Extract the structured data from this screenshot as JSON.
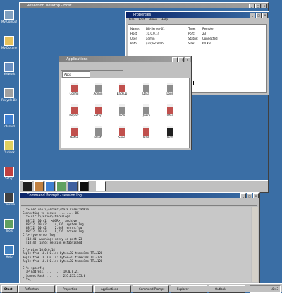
{
  "desktop": {
    "background": "#3a6ea5",
    "icons": [
      {
        "label": "My Computer",
        "icon": "computer-icon",
        "color": "#7f9fbf"
      },
      {
        "label": "My Documents",
        "icon": "folder-icon",
        "color": "#e6c15c"
      },
      {
        "label": "Network",
        "icon": "network-icon",
        "color": "#6a8fc0"
      },
      {
        "label": "Recycle Bin",
        "icon": "recycle-bin-icon",
        "color": "#a0a0a0"
      },
      {
        "label": "Internet",
        "icon": "globe-icon",
        "color": "#3f7fd0"
      },
      {
        "label": "Outlook",
        "icon": "mail-icon",
        "color": "#e0d060"
      },
      {
        "label": "Setup",
        "icon": "setup-icon",
        "color": "#c04040"
      },
      {
        "label": "Console",
        "icon": "console-icon",
        "color": "#404040"
      },
      {
        "label": "Tools",
        "icon": "tools-icon",
        "color": "#60a060"
      },
      {
        "label": "Help",
        "icon": "help-icon",
        "color": "#4080c0"
      }
    ]
  },
  "top_window": {
    "title": "Reflection Desktop - Host"
  },
  "properties_window": {
    "title": "Properties",
    "menu": [
      "File",
      "Edit",
      "View",
      "Help"
    ],
    "rows": [
      [
        "Name:",
        "DB-Server-01",
        "Type:",
        "Remote"
      ],
      [
        "Host:",
        "10.0.0.14",
        "Port:",
        "23"
      ],
      [
        "User:",
        "admin",
        "Status:",
        "Connected"
      ],
      [
        "Path:",
        "/usr/local/db",
        "Size:",
        "64 KB"
      ]
    ]
  },
  "explorer_window": {
    "title": "Applications",
    "address": "Apps",
    "items": [
      {
        "label": "Config",
        "color": "#c0504d"
      },
      {
        "label": "Admin",
        "color": "#8c8c8c"
      },
      {
        "label": "Backup",
        "color": "#c0504d"
      },
      {
        "label": "Data",
        "color": "#8c8c8c"
      },
      {
        "label": "Logs",
        "color": "#8c8c8c"
      },
      {
        "label": "Report",
        "color": "#c0504d"
      },
      {
        "label": "Setup",
        "color": "#c0504d"
      },
      {
        "label": "Tools",
        "color": "#8c8c8c"
      },
      {
        "label": "Query",
        "color": "#8c8c8c"
      },
      {
        "label": "Utils",
        "color": "#c0504d"
      },
      {
        "label": "Notes",
        "color": "#c0504d"
      },
      {
        "label": "Print",
        "color": "#8c8c8c"
      },
      {
        "label": "Sync",
        "color": "#c0504d"
      },
      {
        "label": "Mail",
        "color": "#c0504d"
      },
      {
        "label": "Term",
        "color": "#202020"
      }
    ]
  },
  "terminal": {
    "title": "Command Prompt - session log",
    "lines": [
      "C:\\> net use \\\\server\\share /user:admin",
      "Connecting to server ......... OK",
      "C:\\> dir \\\\server\\share\\logs",
      "  08/12  10:41   <DIR>   archive",
      "  08/12  10:42    14,336  system.log",
      "  08/12  10:42     2,048  error.log",
      "  08/12  10:43     9,216  access.log",
      "C:\\> type error.log",
      "  [10:41] warning: retry on port 23",
      "  [10:42] info: session established",
      "",
      "C:\\> ping 10.0.0.14",
      "Reply from 10.0.0.14: bytes=32 time<1ms TTL=128",
      "Reply from 10.0.0.14: bytes=32 time<1ms TTL=128",
      "Reply from 10.0.0.14: bytes=32 time<1ms TTL=128",
      "",
      "C:\\> ipconfig",
      "  IP Address. . . . . : 10.0.0.21",
      "  Subnet Mask . . . . : 255.255.255.0",
      "C:\\>_"
    ]
  },
  "taskbar": {
    "start_label": "Start",
    "buttons": [
      "Reflection",
      "Properties",
      "Applications",
      "Command Prompt",
      "Explorer",
      "Outlook"
    ],
    "clock": "10:43"
  }
}
